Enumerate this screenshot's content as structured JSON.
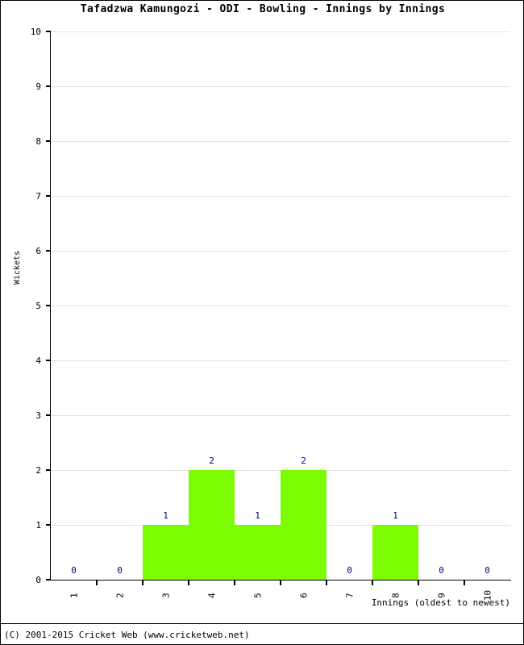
{
  "chart_data": {
    "type": "bar",
    "title": "Tafadzwa Kamungozi - ODI - Bowling - Innings by Innings",
    "xlabel": "Innings (oldest to newest)",
    "ylabel": "Wickets",
    "categories": [
      "1",
      "2",
      "3",
      "4",
      "5",
      "6",
      "7",
      "8",
      "9",
      "10"
    ],
    "values": [
      0,
      0,
      1,
      2,
      1,
      2,
      0,
      1,
      0,
      0
    ],
    "value_labels": [
      "0",
      "0",
      "1",
      "2",
      "1",
      "2",
      "0",
      "1",
      "0",
      "0"
    ],
    "ylim": [
      0,
      10
    ],
    "ytick_labels": [
      "0",
      "1",
      "2",
      "3",
      "4",
      "5",
      "6",
      "7",
      "8",
      "9",
      "10"
    ],
    "ytick_values": [
      0,
      1,
      2,
      3,
      4,
      5,
      6,
      7,
      8,
      9,
      10
    ],
    "grid": true,
    "legend": null,
    "bar_color": "#7CFC00",
    "value_label_color": "#00008B",
    "grid_color": "#E3E3E3",
    "axis_color": "#000000"
  },
  "footer": {
    "copyright": "(C) 2001-2015 Cricket Web (www.cricketweb.net)"
  }
}
